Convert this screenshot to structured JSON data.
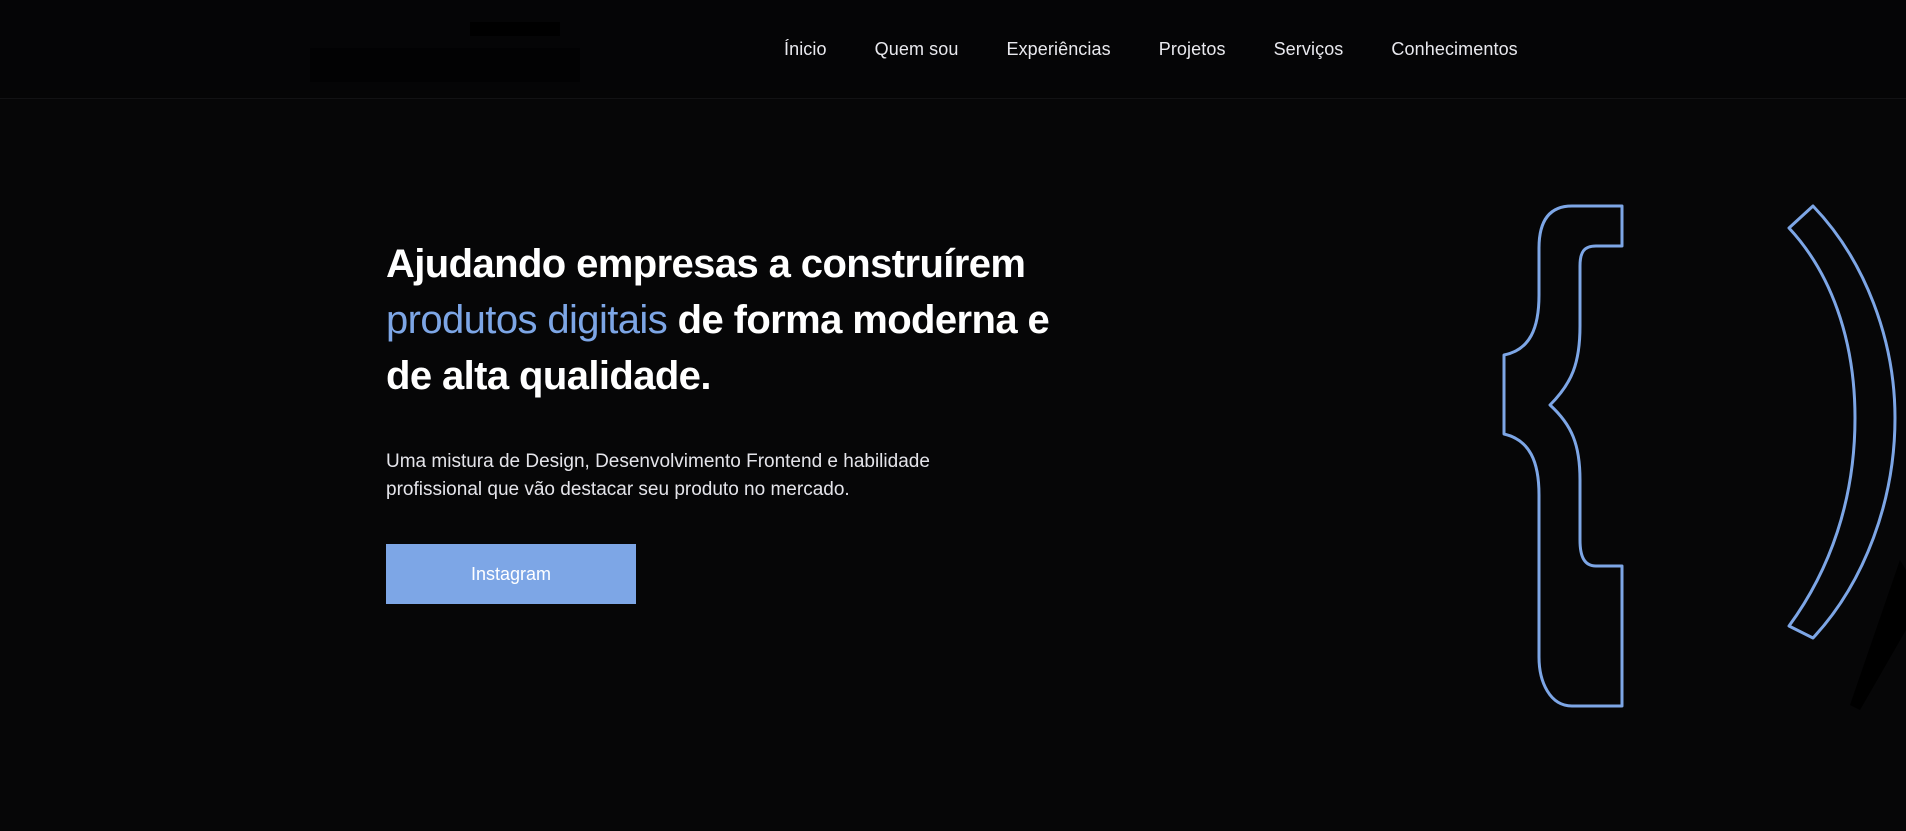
{
  "nav": {
    "items": [
      {
        "label": "Ínicio"
      },
      {
        "label": "Quem sou"
      },
      {
        "label": "Experiências"
      },
      {
        "label": "Projetos"
      },
      {
        "label": "Serviços"
      },
      {
        "label": "Conhecimentos"
      }
    ]
  },
  "hero": {
    "headline_part1": "Ajudando empresas a construírem",
    "headline_accent": "produtos digitais",
    "headline_part2": " de forma moderna e de alta qualidade.",
    "subtitle": "Uma mistura de Design, Desenvolvimento Frontend e habilidade profissional que vão destacar seu produto no mercado.",
    "cta_label": "Instagram"
  },
  "decor": {
    "icon": "code-braces-icon"
  },
  "colors": {
    "background": "#060607",
    "accent": "#7da6e6",
    "text": "#ffffff"
  }
}
